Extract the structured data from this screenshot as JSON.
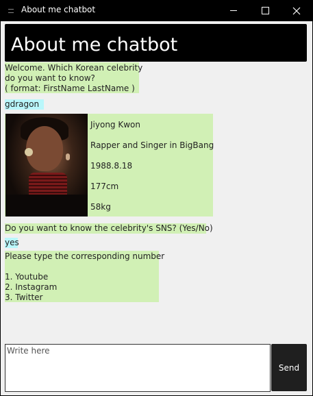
{
  "window": {
    "title": "About me chatbot",
    "icon": "app-icon"
  },
  "header": {
    "title": "About me chatbot"
  },
  "messages": {
    "welcome": "Welcome. Which Korean celebrity\ndo you want to know?\n( format: FirstName LastName )",
    "user_query": "gdragon",
    "profile": {
      "name": "Jiyong Kwon",
      "occupation": "Rapper and Singer in BigBang",
      "birth_date": "1988.8.18",
      "height": "177cm",
      "weight": "58kg"
    },
    "sns_question": "Do you want to know the celebrity's SNS? (Yes/No)",
    "user_answer": "yes",
    "sns_prompt": "Please type the corresponding number\n\n1. Youtube\n2. Instagram\n3. Twitter"
  },
  "composer": {
    "placeholder": "Write here",
    "send_label": "Send"
  },
  "colors": {
    "bot_bubble": "#d1f0b5",
    "user_bubble": "#b9f7fb",
    "header_bg": "#000000",
    "background": "#f0f0f0"
  }
}
